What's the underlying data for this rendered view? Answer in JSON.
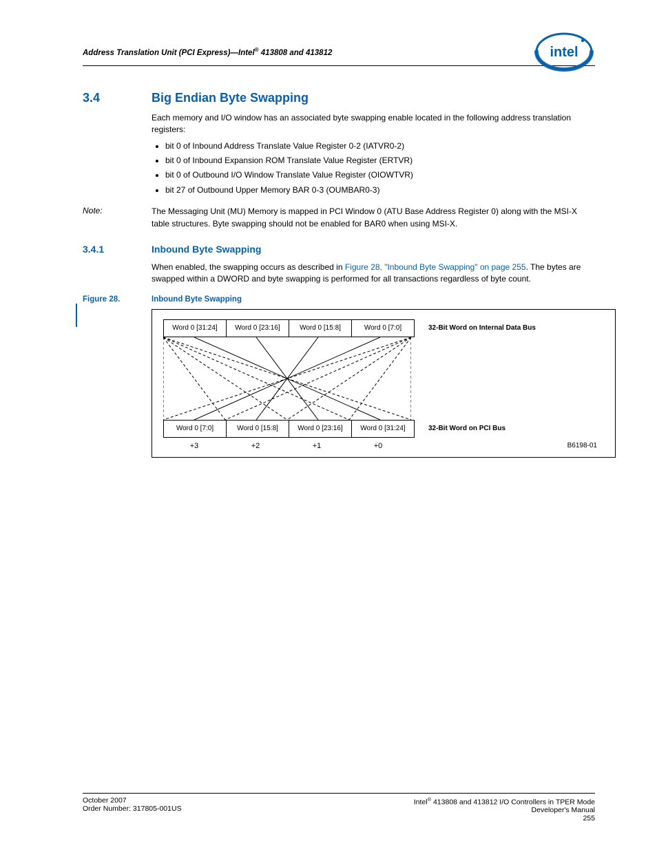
{
  "header": {
    "running": "Address Translation Unit (PCI Express)—Intel® 413808 and 413812"
  },
  "sections": {
    "s34": {
      "num": "3.4",
      "title": "Big Endian Byte Swapping"
    },
    "s341": {
      "num": "3.4.1",
      "title": "Inbound Byte Swapping"
    }
  },
  "paras": {
    "intro": "Each memory and I/O window has an associated byte swapping enable located in the following address translation registers:",
    "bullets": [
      "bit 0 of Inbound Address Translate Value Register 0-2 (IATVR0-2)",
      "bit 0 of Inbound Expansion ROM Translate Value Register (ERTVR)",
      "bit 0 of Outbound I/O Window Translate Value Register (OIOWTVR)",
      "bit 27 of Outbound Upper Memory BAR 0-3 (OUMBAR0-3)"
    ],
    "note_label": "Note:",
    "note": "The Messaging Unit (MU) Memory is mapped in PCI Window 0 (ATU Base Address Register 0) along with the MSI-X table structures. Byte swapping should not be enabled for BAR0 when using MSI-X.",
    "swap_pre": "When enabled, the swapping occurs as described in ",
    "swap_xref": "Figure 28, \"Inbound Byte Swapping\" on page 255",
    "swap_post": ". The bytes are swapped within a DWORD and byte swapping is performed for all transactions regardless of byte count."
  },
  "figure": {
    "num": "Figure 28.",
    "title": "Inbound Byte Swapping",
    "top_row": [
      "Word 0 [31:24]",
      "Word 0 [23:16]",
      "Word 0 [15:8]",
      "Word 0 [7:0]"
    ],
    "top_label": "32-Bit Word on Internal Data Bus",
    "bot_row": [
      "Word 0 [7:0]",
      "Word 0 [15:8]",
      "Word 0 [23:16]",
      "Word 0 [31:24]"
    ],
    "bot_label": "32-Bit Word on PCI Bus",
    "offsets": [
      "+3",
      "+2",
      "+1",
      "+0"
    ],
    "id": "B6198-01"
  },
  "footer": {
    "left1": "October 2007",
    "left2": "Order Number: 317805-001US",
    "right1": "Intel® 413808 and 413812 I/O Controllers in TPER Mode",
    "right2": "Developer's Manual",
    "right3": "255"
  }
}
